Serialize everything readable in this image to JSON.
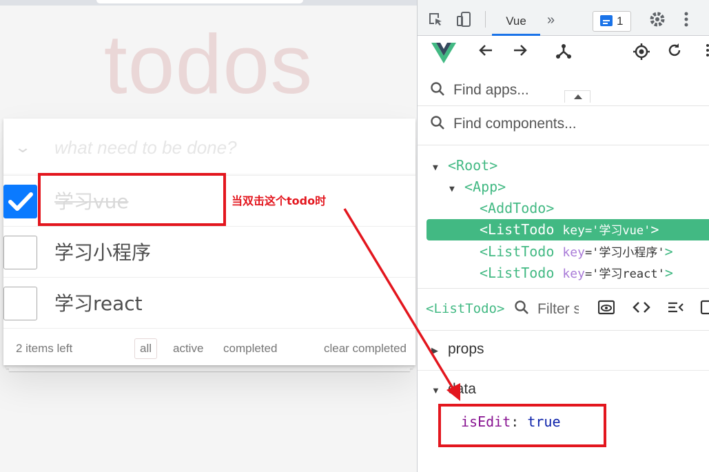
{
  "todo_app": {
    "title": "todos",
    "new_todo_placeholder": "what need to be done?",
    "toggle_all_glyph": "⌄",
    "items": [
      {
        "label": "学习vue",
        "completed": true
      },
      {
        "label": "学习小程序",
        "completed": false
      },
      {
        "label": "学习react",
        "completed": false
      }
    ],
    "footer": {
      "items_left": "2 items left",
      "filters": [
        "all",
        "active",
        "completed"
      ],
      "selected_filter": "all",
      "clear_completed": "clear completed"
    }
  },
  "devtools": {
    "active_tab": "Vue",
    "more_tabs_glyph": "»",
    "issues_count": "1",
    "find_apps_placeholder": "Find apps...",
    "find_components_placeholder": "Find components...",
    "component_tree": [
      {
        "tag_open": "<Root>",
        "expanded": true,
        "depth": 0
      },
      {
        "tag_open": "<App>",
        "expanded": true,
        "depth": 1
      },
      {
        "tag_open": "<AddTodo>",
        "depth": 2
      },
      {
        "tag_open": "<ListTodo",
        "key_name": "key",
        "key_value": "='学习vue'",
        "tag_close": ">",
        "depth": 2,
        "selected": true
      },
      {
        "tag_open": "<ListTodo",
        "key_name": "key",
        "key_value": "='学习小程序'",
        "tag_close": ">",
        "depth": 2
      },
      {
        "tag_open": "<ListTodo",
        "key_name": "key",
        "key_value": "='学习react'",
        "tag_close": ">",
        "depth": 2
      }
    ],
    "inspector": {
      "component_name": "<ListTodo>",
      "filter_placeholder": "Filter s",
      "sections": [
        {
          "title": "props",
          "expanded": false
        },
        {
          "title": "data",
          "expanded": true
        }
      ],
      "data_props": [
        {
          "key": "isEdit",
          "value": "true"
        }
      ]
    },
    "accent_color": "#42b983"
  },
  "annotation": {
    "text": "当双击这个todo时",
    "color": "#e3161e"
  }
}
